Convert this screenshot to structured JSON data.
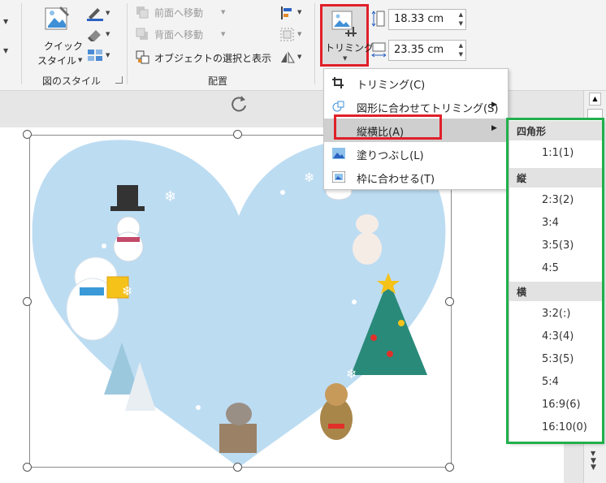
{
  "ribbon": {
    "quick_style_label_1": "クイック",
    "quick_style_label_2": "スタイル",
    "picture_styles_group": "図のスタイル",
    "bring_forward": "前面へ移動",
    "send_backward": "背面へ移動",
    "selection_pane": "オブジェクトの選択と表示",
    "arrange_group": "配置",
    "crop_label": "トリミング",
    "height_value": "18.33 cm",
    "width_value": "23.35 cm"
  },
  "crop_menu": {
    "items": [
      {
        "label": "トリミング(C)",
        "icon": "crop-icon"
      },
      {
        "label": "図形に合わせてトリミング(S)",
        "icon": "shapes-icon"
      },
      {
        "label": "縦横比(A)",
        "icon": "none"
      },
      {
        "label": "塗りつぶし(L)",
        "icon": "fill-icon"
      },
      {
        "label": "枠に合わせる(T)",
        "icon": "fit-icon"
      }
    ]
  },
  "aspect_menu": {
    "square_header": "四角形",
    "square": [
      "1:1(1)"
    ],
    "portrait_header": "縦",
    "portrait": [
      "2:3(2)",
      "3:4",
      "3:5(3)",
      "4:5"
    ],
    "landscape_header": "横",
    "landscape": [
      "3:2(:)",
      "4:3(4)",
      "5:3(5)",
      "5:4",
      "16:9(6)",
      "16:10(0)"
    ]
  },
  "colors": {
    "highlight_red": "#e0202a",
    "highlight_green": "#22b04c",
    "heart_fill": "#bcdcf2"
  }
}
